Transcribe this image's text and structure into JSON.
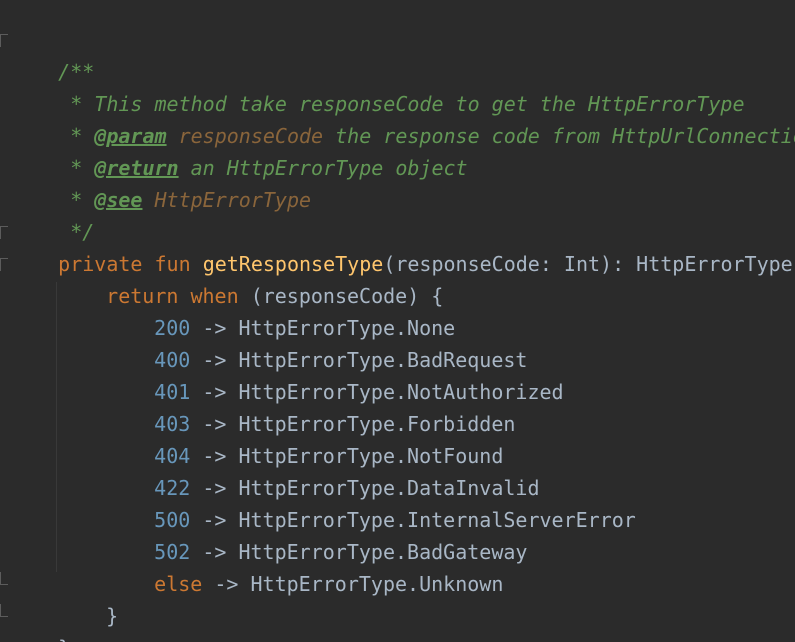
{
  "code": {
    "doc_open": "/**",
    "doc_line1": " * This method take responseCode to get the HttpErrorType",
    "doc_star": " * ",
    "doc_param_tag": "@param",
    "doc_param_name": "responseCode",
    "doc_param_desc": " the response code from HttpUrlConnection",
    "doc_return_tag": "@return",
    "doc_return_desc": " an HttpErrorType object",
    "doc_see_tag": "@see",
    "doc_see_ref": "HttpErrorType",
    "doc_close": " */",
    "kw_private": "private",
    "kw_fun": "fun",
    "fn_name": "getResponseType",
    "fn_params": "(responseCode: Int): HttpErrorType {",
    "kw_return": "return",
    "kw_when": "when",
    "when_subject": "(responseCode) {",
    "arrow": " -> ",
    "cases": [
      {
        "code": "200",
        "result": "HttpErrorType.None"
      },
      {
        "code": "400",
        "result": "HttpErrorType.BadRequest"
      },
      {
        "code": "401",
        "result": "HttpErrorType.NotAuthorized"
      },
      {
        "code": "403",
        "result": "HttpErrorType.Forbidden"
      },
      {
        "code": "404",
        "result": "HttpErrorType.NotFound"
      },
      {
        "code": "422",
        "result": "HttpErrorType.DataInvalid"
      },
      {
        "code": "500",
        "result": "HttpErrorType.InternalServerError"
      },
      {
        "code": "502",
        "result": "HttpErrorType.BadGateway"
      }
    ],
    "kw_else": "else",
    "else_result": "HttpErrorType.Unknown",
    "close_when": "}",
    "close_fun": "}"
  },
  "colors": {
    "background": "#2b2b2b",
    "comment": "#629755",
    "keyword": "#cc7832",
    "function": "#ffc66d",
    "number": "#6897bb",
    "text": "#a9b7c6",
    "param": "#8a653b"
  }
}
